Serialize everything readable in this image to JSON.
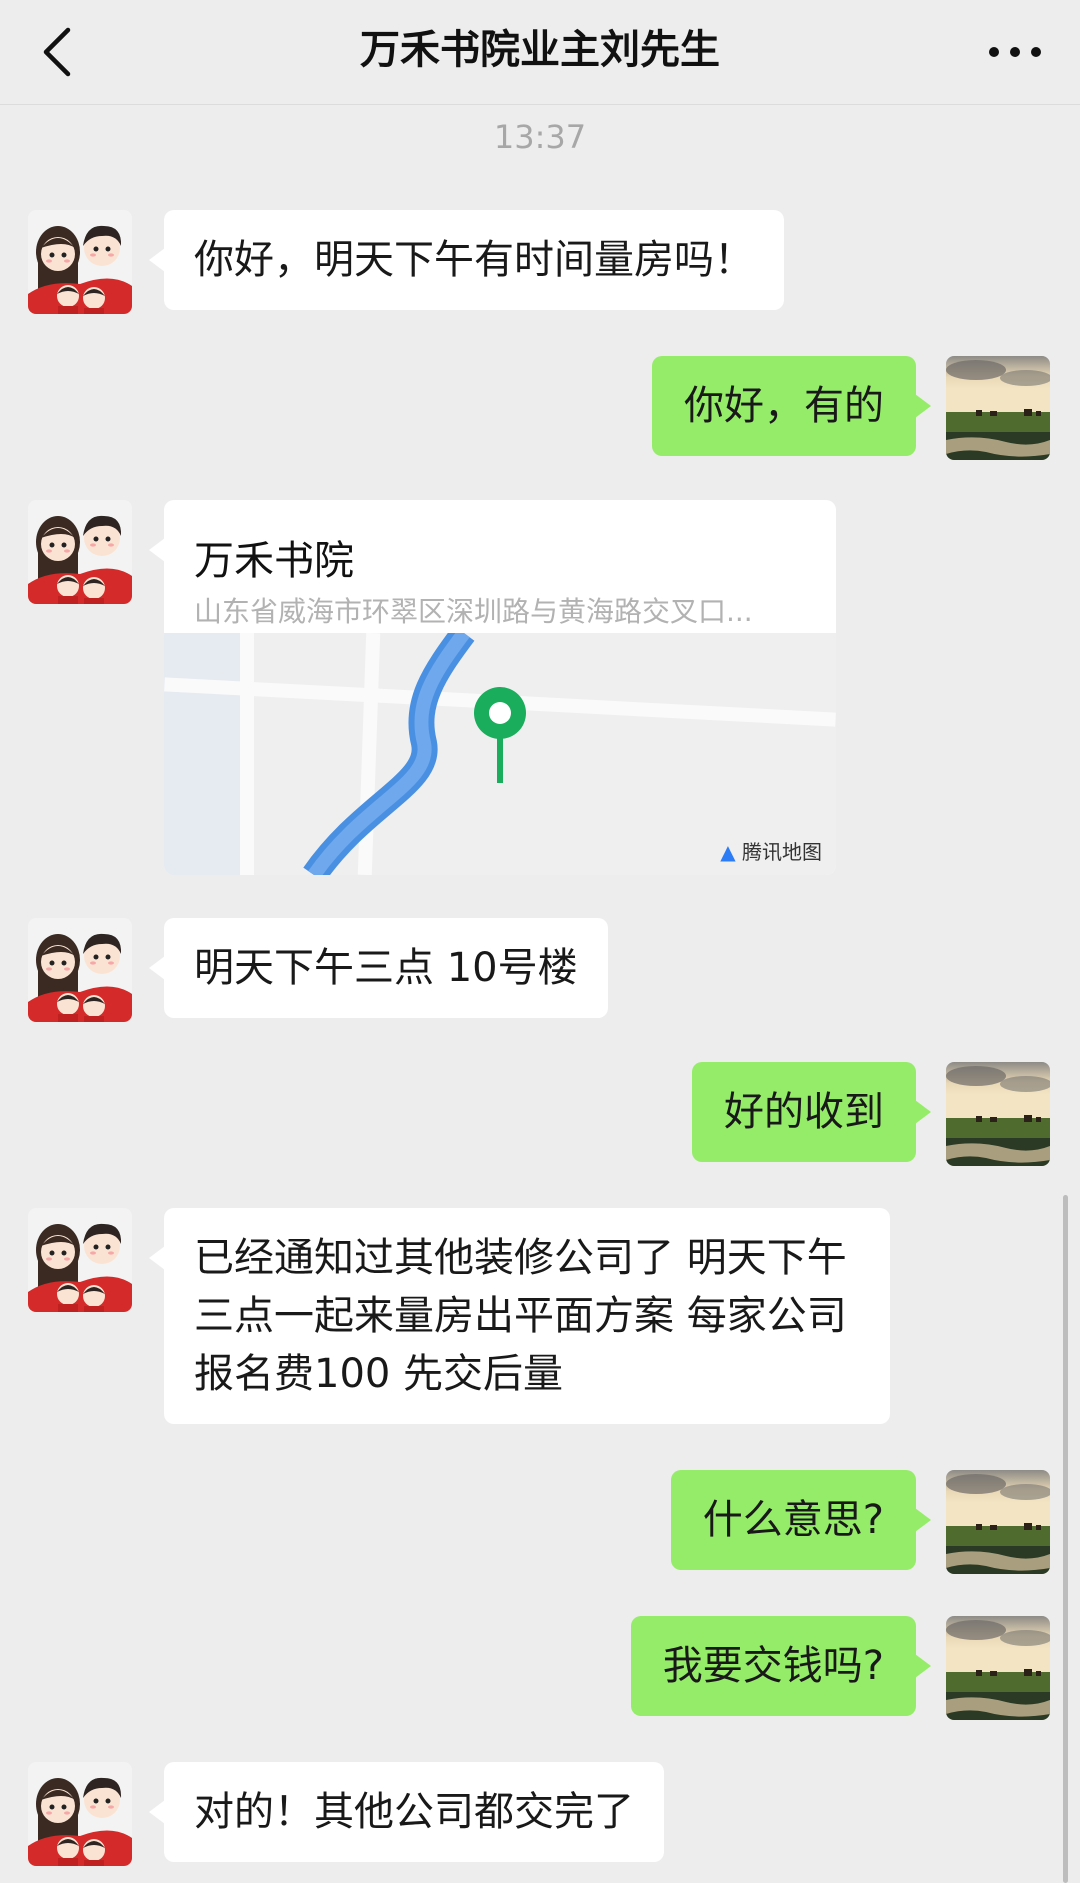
{
  "header": {
    "title": "万禾书院业主刘先生",
    "back_icon": "chevron-left-icon",
    "more_icon": "more-dots-icon"
  },
  "chat": {
    "timestamp": "13:37",
    "messages": [
      {
        "from": "other",
        "text": "你好，明天下午有时间量房吗！"
      },
      {
        "from": "me",
        "text": "你好，有的"
      },
      {
        "from": "other",
        "type": "location",
        "name": "万禾书院",
        "address": "山东省威海市环翠区深圳路与黄海路交叉口...",
        "map_provider": "腾讯地图"
      },
      {
        "from": "other",
        "text": "明天下午三点  10号楼"
      },
      {
        "from": "me",
        "text": "好的收到"
      },
      {
        "from": "other",
        "text": "已经通知过其他装修公司了  明天下午三点一起来量房出平面方案  每家公司报名费100  先交后量"
      },
      {
        "from": "me",
        "text": "什么意思?"
      },
      {
        "from": "me",
        "text": "我要交钱吗?"
      },
      {
        "from": "other",
        "text": "对的！其他公司都交完了"
      }
    ]
  },
  "colors": {
    "background": "#ededed",
    "incoming_bubble": "#ffffff",
    "outgoing_bubble": "#95ec69",
    "map_pin": "#1aad5c",
    "river": "#4a90e2"
  }
}
